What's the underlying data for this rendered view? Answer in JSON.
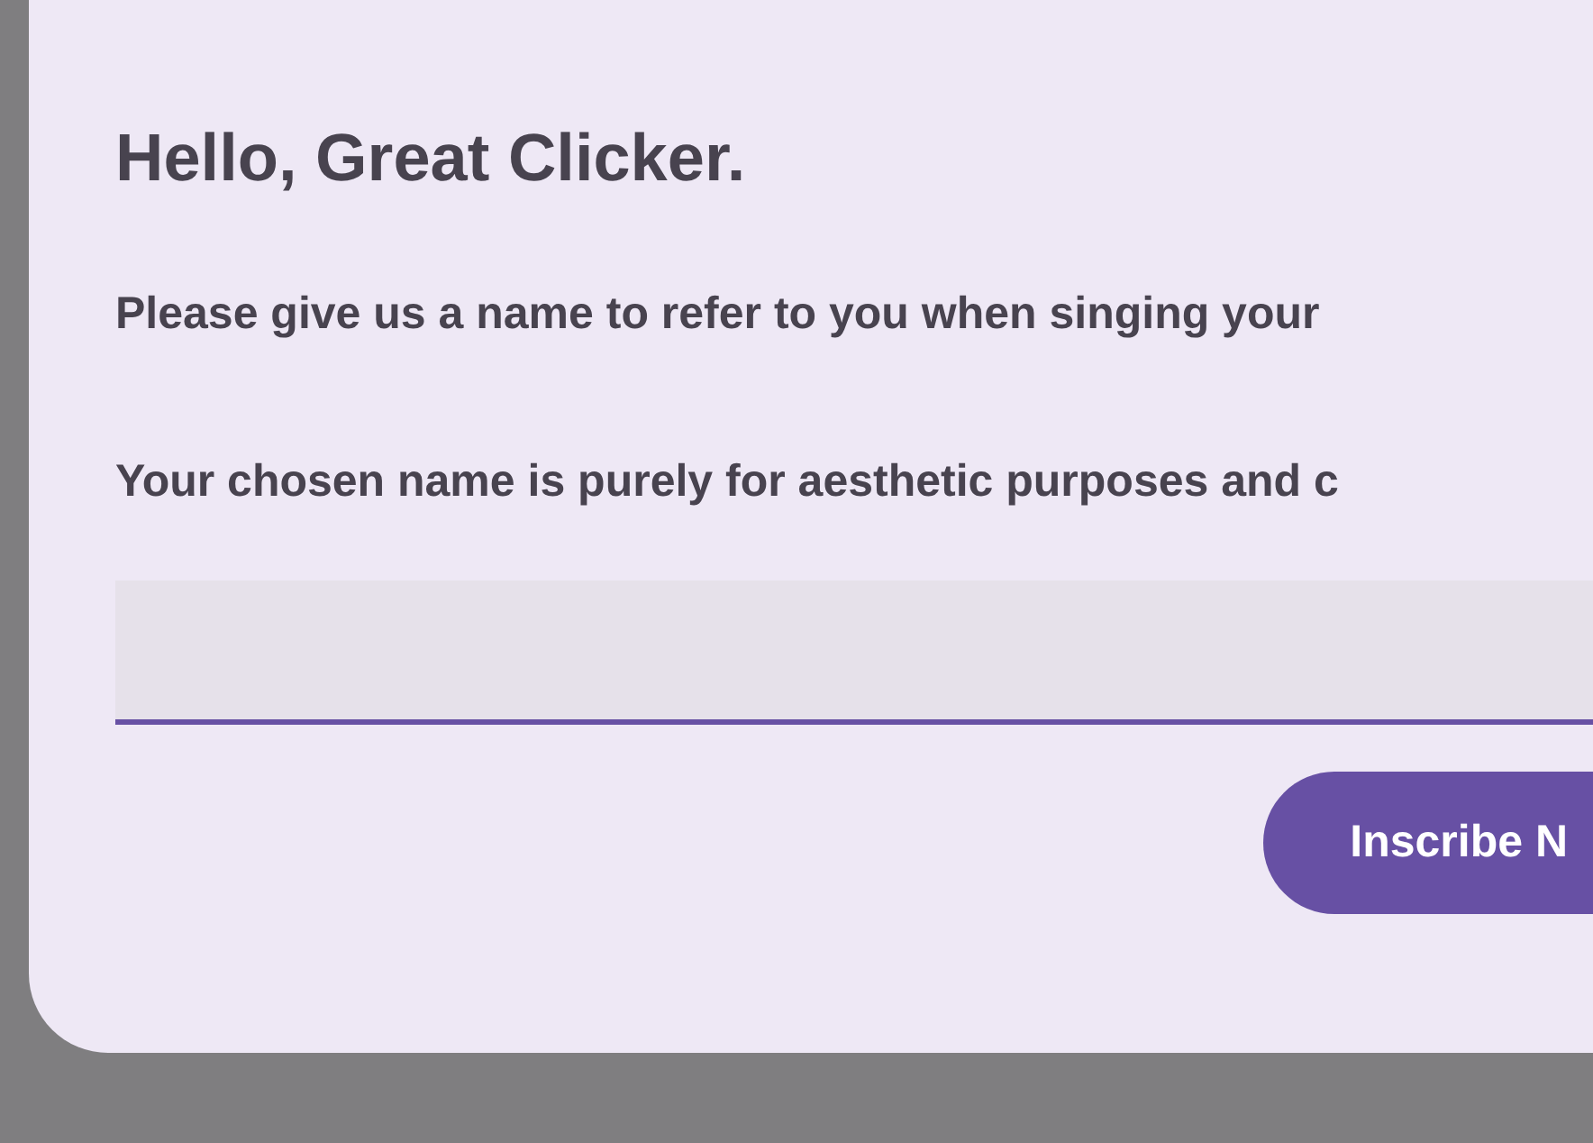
{
  "dialog": {
    "title": "Hello, Great Clicker.",
    "paragraphs": [
      "Please give us a name to refer to you when singing your",
      "Your chosen name is purely for aesthetic purposes and c"
    ],
    "submit_button": {
      "label": "Inscribe N"
    }
  }
}
